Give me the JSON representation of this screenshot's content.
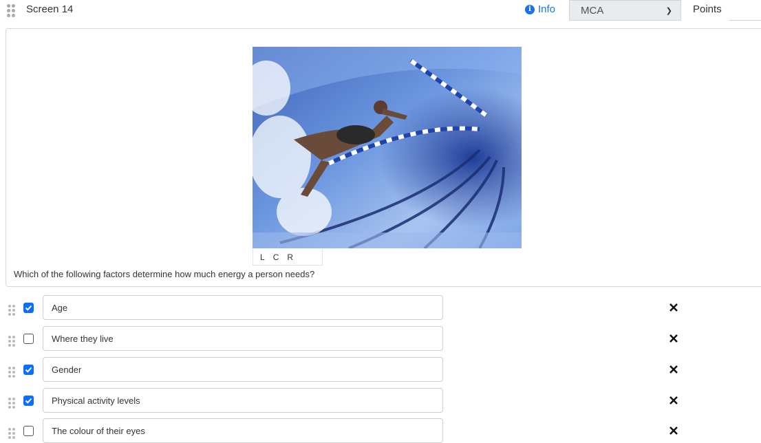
{
  "header": {
    "screen_title": "Screen 14",
    "info_label": "Info",
    "question_type": "MCA",
    "points_label": "Points",
    "points_value": ""
  },
  "question": {
    "image_icon": "swimmer-photo",
    "align_options": [
      "L",
      "C",
      "R"
    ],
    "text": "Which of the following factors determine how much energy a person needs?"
  },
  "options": [
    {
      "label": "Age",
      "checked": true
    },
    {
      "label": "Where they live",
      "checked": false
    },
    {
      "label": "Gender",
      "checked": true
    },
    {
      "label": "Physical activity levels",
      "checked": true
    },
    {
      "label": "The colour of their eyes",
      "checked": false
    }
  ],
  "colors": {
    "accent": "#1a73e8",
    "checkbox": "#0d6efd"
  }
}
